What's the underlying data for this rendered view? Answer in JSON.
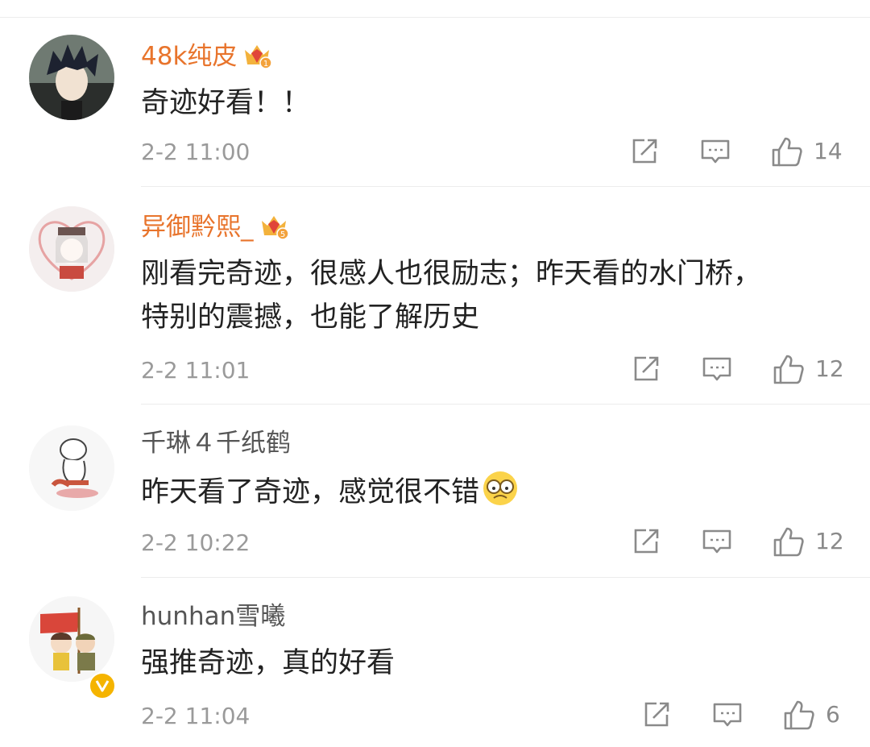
{
  "comments": [
    {
      "user": "48k纯皮",
      "text": "奇迹好看！！",
      "time": "2-2 11:00",
      "likes": "14",
      "badge_level": "1"
    },
    {
      "user": "异御黔熙_",
      "text_lines": [
        "刚看完奇迹，很感人也很励志；昨天看的水门桥，",
        "特别的震撼，也能了解历史"
      ],
      "time": "2-2 11:01",
      "likes": "12",
      "badge_level": "5"
    },
    {
      "user": "千琳４千纸鹤",
      "text": "昨天看了奇迹，感觉很不错",
      "time": "2-2 10:22",
      "likes": "12"
    },
    {
      "user": "hunhan雪曦",
      "text": "强推奇迹，真的好看",
      "time": "2-2 11:04",
      "likes": "6"
    }
  ],
  "colors": {
    "vip_name": "#e8742c",
    "plain_name": "#555555",
    "icon": "#8a8a8a",
    "verified_badge": "#f5b400"
  },
  "icons": [
    "share-icon",
    "comment-icon",
    "like-icon",
    "crown-badge-icon",
    "verified-badge-icon"
  ]
}
